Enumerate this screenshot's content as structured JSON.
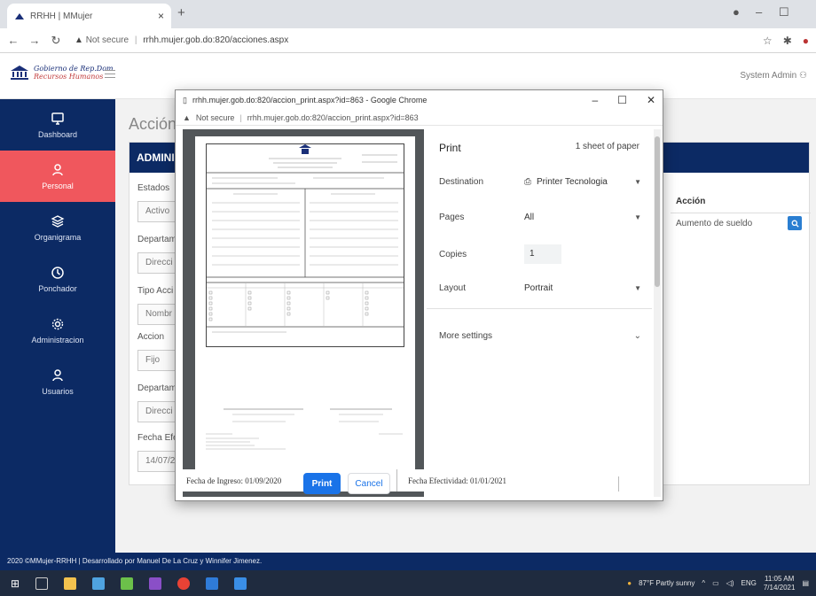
{
  "browser": {
    "tab_title": "RRHH | MMujer",
    "url_notsecure": "Not secure",
    "url": "rrhh.mujer.gob.do:820/acciones.aspx"
  },
  "header": {
    "logo_line1": "Gobierno de Rep.Dom.",
    "logo_line2": "Recursos Humanos",
    "user": "System Admin"
  },
  "sidebar": {
    "items": [
      {
        "label": "Dashboard",
        "icon": "monitor-icon"
      },
      {
        "label": "Personal",
        "icon": "user-icon"
      },
      {
        "label": "Organigrama",
        "icon": "layers-icon"
      },
      {
        "label": "Ponchador",
        "icon": "clock-icon"
      },
      {
        "label": "Administracion",
        "icon": "gear-icon"
      },
      {
        "label": "Usuarios",
        "icon": "user-icon"
      }
    ]
  },
  "main": {
    "title": "Acción",
    "card_header": "ADMINI",
    "labels": [
      "Estados",
      "Departam",
      "Tipo Acci",
      "Accion",
      "Departam",
      "Fecha Efe"
    ],
    "values": [
      "Activo",
      "Direcci",
      "Nombr",
      "Fijo",
      "Direcci",
      "14/07/2"
    ],
    "table_header": "Acción",
    "table_row": "Aumento de sueldo"
  },
  "footer": {
    "text": "2020 ©MMujer-RRHH | Desarrollado por Manuel De La Cruz y Winnifer Jimenez."
  },
  "taskbar": {
    "weather": "87°F  Partly sunny",
    "lang": "ENG",
    "time": "11:05 AM",
    "date": "7/14/2021"
  },
  "popup": {
    "title": "rrhh.mujer.gob.do:820/accion_print.aspx?id=863 - Google Chrome",
    "notsecure": "Not secure",
    "url": "rrhh.mujer.gob.do:820/accion_print.aspx?id=863",
    "print": {
      "title": "Print",
      "sheets": "1 sheet of paper",
      "destination_label": "Destination",
      "destination_value": "Printer Tecnologia",
      "pages_label": "Pages",
      "pages_value": "All",
      "copies_label": "Copies",
      "copies_value": "1",
      "layout_label": "Layout",
      "layout_value": "Portrait",
      "more_settings": "More settings",
      "print_button": "Print",
      "cancel_button": "Cancel"
    },
    "strip": {
      "ingreso": "Fecha de Ingreso:   01/09/2020",
      "efectividad": "Fecha Efectividad:  01/01/2021"
    }
  }
}
